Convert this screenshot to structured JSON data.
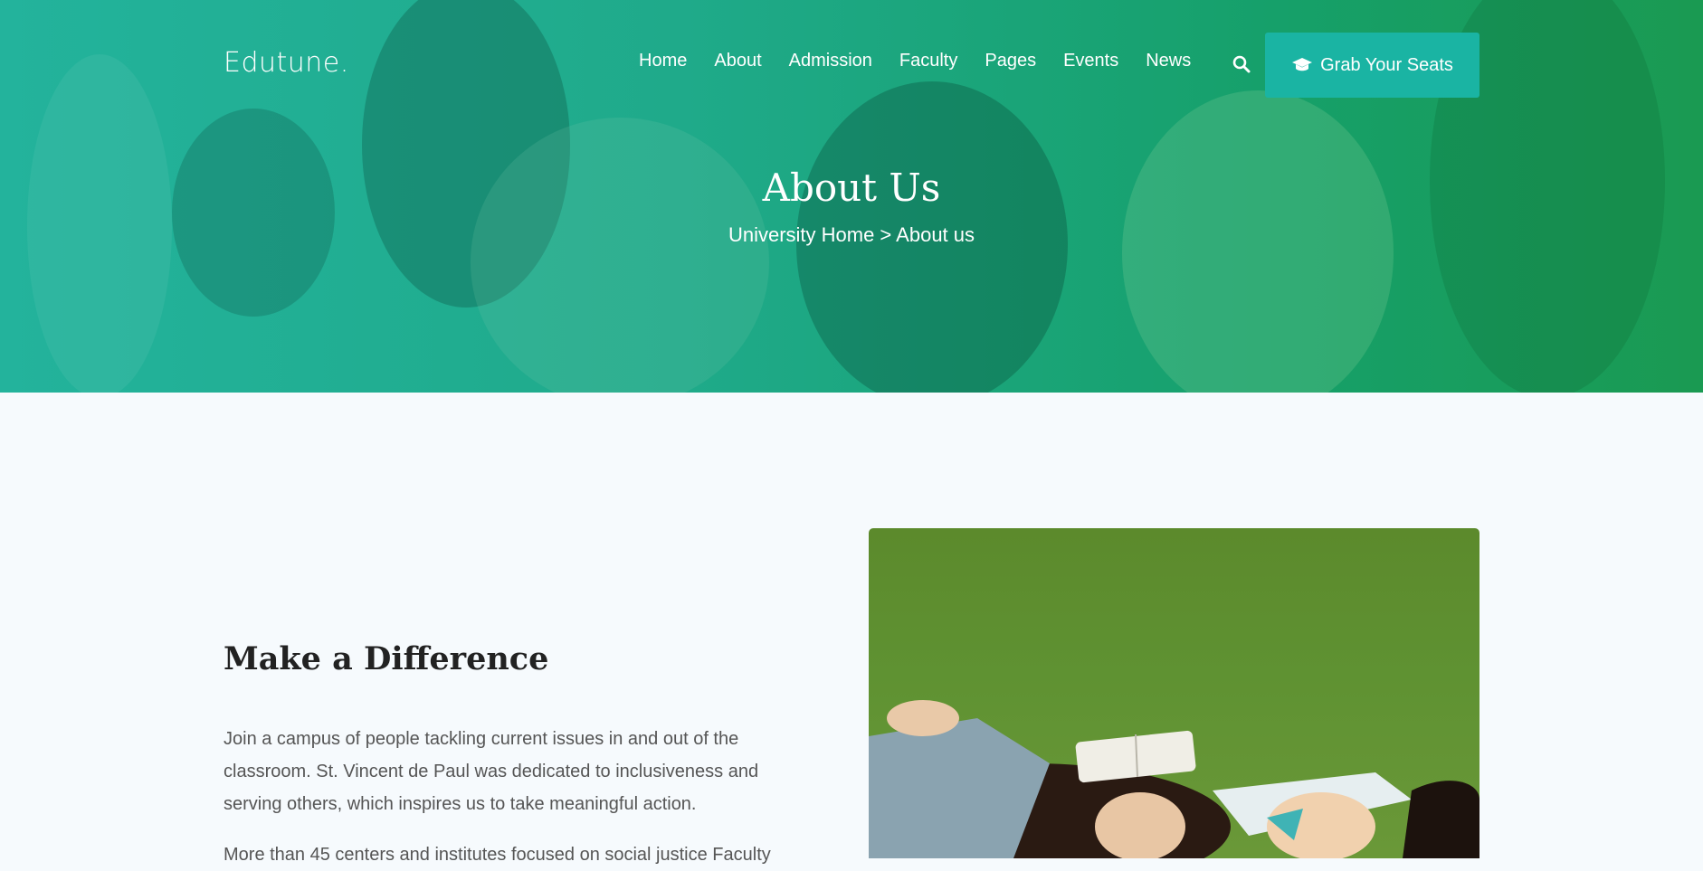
{
  "brand": {
    "logo": "Edutune."
  },
  "nav": {
    "items": [
      {
        "label": "Home"
      },
      {
        "label": "About"
      },
      {
        "label": "Admission"
      },
      {
        "label": "Faculty"
      },
      {
        "label": "Pages"
      },
      {
        "label": "Events"
      },
      {
        "label": "News"
      }
    ],
    "search_icon": "search-icon",
    "cta_label": "Grab Your Seats",
    "cta_icon": "graduation-cap-icon"
  },
  "hero": {
    "title": "About Us",
    "breadcrumb": "University Home > About us"
  },
  "about": {
    "title": "Make a Difference",
    "paragraph_1": "Join a campus of people tackling current issues in and out of the classroom. St. Vincent de Paul was dedicated to inclusiveness and serving others, which inspires us to take meaningful action.",
    "paragraph_2": "More than 45 centers and institutes focused on social justice Faculty"
  },
  "colors": {
    "hero_start": "#23b39c",
    "hero_end": "#1a9a52",
    "cta": "#1ab4a3",
    "page_bg": "#f6fafd",
    "heading": "#222222",
    "body_text": "#555555"
  }
}
